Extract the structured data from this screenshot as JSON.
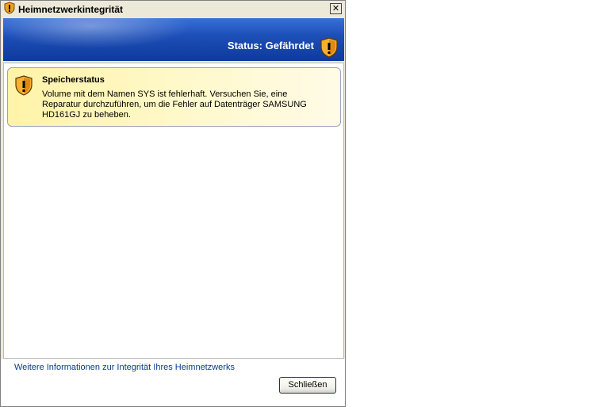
{
  "window": {
    "title": "Heimnetzwerkintegrität",
    "close_glyph": "✕"
  },
  "banner": {
    "status": "Status: Gefährdet",
    "icon": "warning-shield-icon"
  },
  "alert": {
    "heading": "Speicherstatus",
    "message": "Volume mit dem Namen SYS ist fehlerhaft. Versuchen Sie, eine Reparatur durchzuführen, um die Fehler auf Datenträger SAMSUNG HD161GJ zu beheben.",
    "icon": "warning-shield-icon"
  },
  "footer": {
    "link": "Weitere Informationen zur Integrität Ihres Heimnetzwerks",
    "close_button": "Schließen"
  },
  "colors": {
    "banner": "#1d4fb8",
    "shield": "#f0a020",
    "alert_bg": "#fff6b8",
    "link": "#0b3b8c"
  }
}
